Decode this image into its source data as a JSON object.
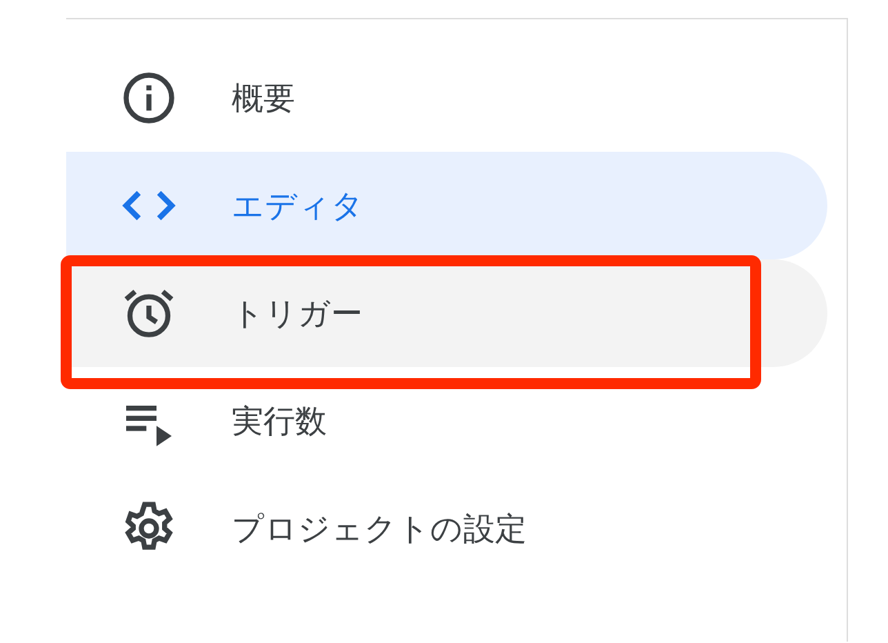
{
  "nav": {
    "items": [
      {
        "kind": "info",
        "label": "概要",
        "selected": false,
        "hovered": false,
        "highlighted": false
      },
      {
        "kind": "code",
        "label": "エディタ",
        "selected": true,
        "hovered": false,
        "highlighted": false
      },
      {
        "kind": "alarm",
        "label": "トリガー",
        "selected": false,
        "hovered": true,
        "highlighted": true
      },
      {
        "kind": "executions",
        "label": "実行数",
        "selected": false,
        "hovered": false,
        "highlighted": false
      },
      {
        "kind": "settings",
        "label": "プロジェクトの設定",
        "selected": false,
        "hovered": false,
        "highlighted": false
      }
    ]
  }
}
